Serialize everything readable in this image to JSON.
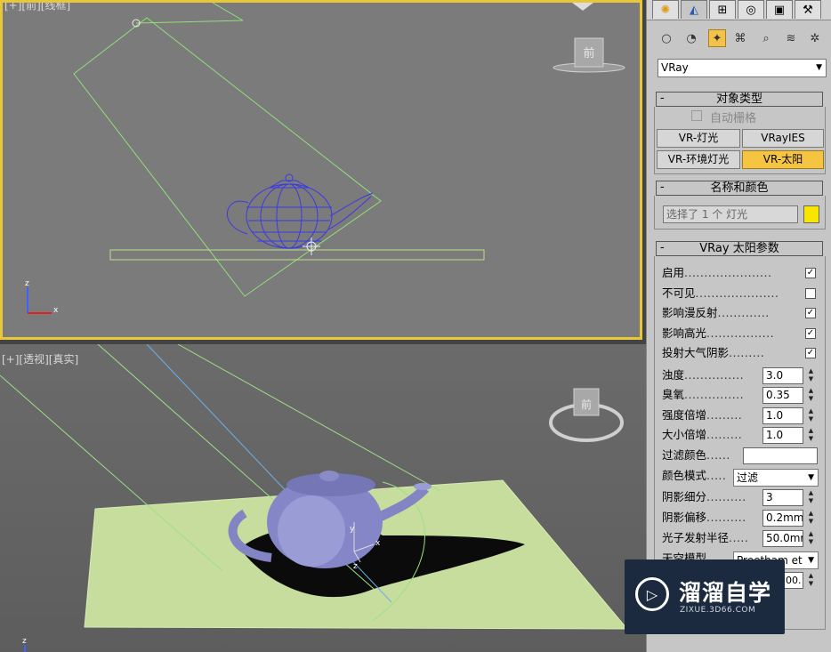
{
  "viewports": {
    "front": {
      "label": "[+][前][线框]"
    },
    "perspective": {
      "label": "[+][透视][真实]"
    },
    "viewcube_label": "前"
  },
  "command_panel": {
    "tabs": [
      "create-icon",
      "modify-icon",
      "hierarchy-icon",
      "motion-icon",
      "display-icon",
      "utilities-icon"
    ],
    "category_icons": [
      "geometry-icon",
      "shapes-icon",
      "lights-icon",
      "cameras-icon",
      "helpers-icon",
      "spacewarps-icon",
      "systems-icon"
    ],
    "type_dropdown": "VRay",
    "object_type": {
      "title": "对象类型",
      "autogrid": "自动栅格",
      "buttons": [
        "VR-灯光",
        "VRayIES",
        "VR-环境灯光",
        "VR-太阳"
      ],
      "active_button": "VR-太阳"
    },
    "name_color": {
      "title": "名称和颜色",
      "name_value": "选择了 1 个 灯光",
      "swatch_color": "#f7e600"
    },
    "sun_params": {
      "title": "VRay 太阳参数",
      "checks": [
        {
          "label": "启用",
          "checked": true
        },
        {
          "label": "不可见",
          "checked": false
        },
        {
          "label": "影响漫反射",
          "checked": true
        },
        {
          "label": "影响高光",
          "checked": true
        },
        {
          "label": "投射大气阴影",
          "checked": true
        }
      ],
      "spinners": [
        {
          "label": "浊度",
          "value": "3.0"
        },
        {
          "label": "臭氧",
          "value": "0.35"
        },
        {
          "label": "强度倍增",
          "value": "1.0"
        },
        {
          "label": "大小倍增",
          "value": "1.0"
        }
      ],
      "filter_color_label": "过滤颜色",
      "color_mode_label": "颜色模式",
      "color_mode_value": "过滤",
      "shadow_subdivs_label": "阴影细分",
      "shadow_subdivs_value": "3",
      "shadow_bias_label": "阴影偏移",
      "shadow_bias_value": "0.2mm",
      "photon_radius_label": "光子发射半径",
      "photon_radius_value": "50.0mr",
      "sky_model_label": "天空模型",
      "sky_model_value": "Preetham et",
      "partial_value": "00."
    }
  },
  "watermark": {
    "title": "溜溜自学",
    "url": "ZIXUE.3D66.COM"
  }
}
